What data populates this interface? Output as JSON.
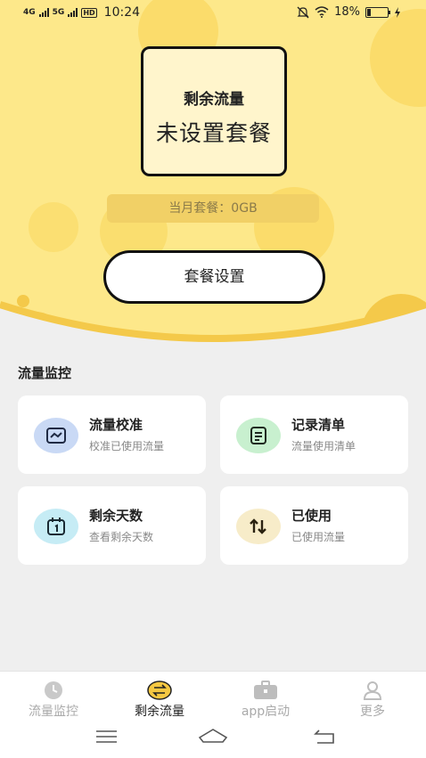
{
  "status": {
    "net1": "4G",
    "net2": "5G",
    "hd": "HD",
    "time": "10:24",
    "battery": "18%"
  },
  "hero": {
    "remaining_label": "剩余流量",
    "plan_status": "未设置套餐",
    "monthly_plan": "当月套餐：0GB",
    "setup_button": "套餐设置"
  },
  "section": {
    "title": "流量监控"
  },
  "tiles": [
    {
      "title": "流量校准",
      "subtitle": "校准已使用流量",
      "icon": "chart-icon",
      "color": "#c9d9f5"
    },
    {
      "title": "记录清单",
      "subtitle": "流量使用清单",
      "icon": "list-icon",
      "color": "#c8f0cf"
    },
    {
      "title": "剩余天数",
      "subtitle": "查看剩余天数",
      "icon": "calendar-icon",
      "color": "#c6ecf5"
    },
    {
      "title": "已使用",
      "subtitle": "已使用流量",
      "icon": "usage-icon",
      "color": "#f7ecc9"
    }
  ],
  "tabs": [
    {
      "label": "流量监控",
      "icon": "clock-icon",
      "active": false
    },
    {
      "label": "剩余流量",
      "icon": "swap-icon",
      "active": true
    },
    {
      "label": "app启动",
      "icon": "briefcase-icon",
      "active": false
    },
    {
      "label": "更多",
      "icon": "person-icon",
      "active": false
    }
  ],
  "colors": {
    "hero_bg": "#fde88a",
    "accent": "#f5c842",
    "page_bg": "#efefef"
  }
}
